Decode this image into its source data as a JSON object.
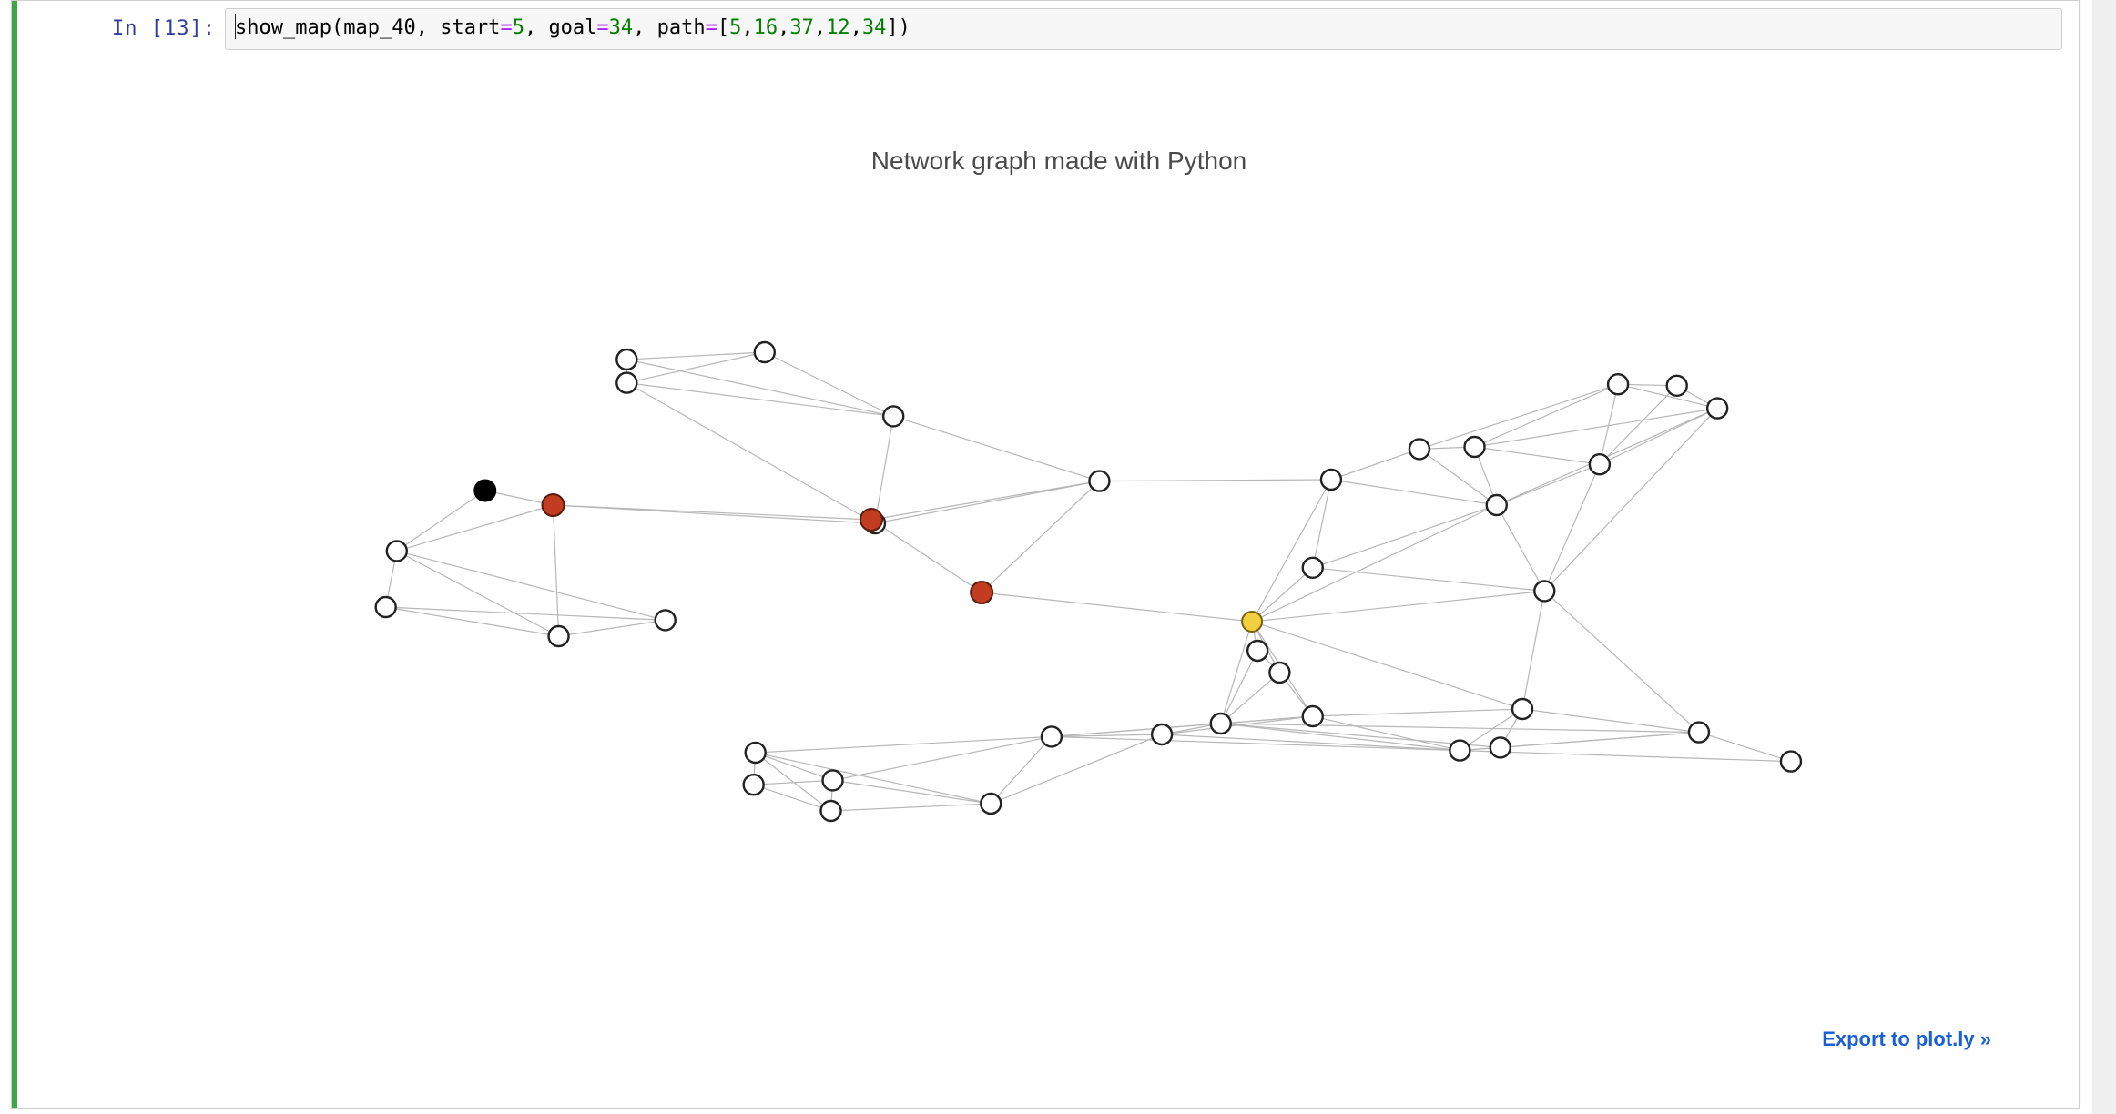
{
  "cell": {
    "prompt_prefix": "In [",
    "prompt_number": "13",
    "prompt_suffix": "]:",
    "code_tokens": [
      {
        "t": "show_map",
        "c": "tok-fn"
      },
      {
        "t": "(",
        "c": "tok-plain"
      },
      {
        "t": "map_40",
        "c": "tok-plain"
      },
      {
        "t": ", ",
        "c": "tok-plain"
      },
      {
        "t": "start",
        "c": "tok-plain"
      },
      {
        "t": "=",
        "c": "tok-eq"
      },
      {
        "t": "5",
        "c": "tok-num"
      },
      {
        "t": ", ",
        "c": "tok-plain"
      },
      {
        "t": "goal",
        "c": "tok-plain"
      },
      {
        "t": "=",
        "c": "tok-eq"
      },
      {
        "t": "34",
        "c": "tok-num"
      },
      {
        "t": ", ",
        "c": "tok-plain"
      },
      {
        "t": "path",
        "c": "tok-plain"
      },
      {
        "t": "=",
        "c": "tok-eq"
      },
      {
        "t": "[",
        "c": "tok-plain"
      },
      {
        "t": "5",
        "c": "tok-num"
      },
      {
        "t": ",",
        "c": "tok-plain"
      },
      {
        "t": "16",
        "c": "tok-num"
      },
      {
        "t": ",",
        "c": "tok-plain"
      },
      {
        "t": "37",
        "c": "tok-num"
      },
      {
        "t": ",",
        "c": "tok-plain"
      },
      {
        "t": "12",
        "c": "tok-num"
      },
      {
        "t": ",",
        "c": "tok-plain"
      },
      {
        "t": "34",
        "c": "tok-num"
      },
      {
        "t": "])",
        "c": "tok-plain"
      }
    ]
  },
  "plot": {
    "title": "Network graph made with Python",
    "export_link": "Export to plot.ly »"
  },
  "chart_data": {
    "type": "network",
    "title": "Network graph made with Python",
    "x_range": [
      0,
      1
    ],
    "y_range": [
      0,
      1
    ],
    "start_node": 5,
    "goal_node": 34,
    "path": [
      5,
      16,
      37,
      12,
      34
    ],
    "node_roles": {
      "start": [
        5
      ],
      "path": [
        16,
        37,
        12
      ],
      "goal": [
        34
      ]
    },
    "nodes": [
      {
        "id": 0,
        "x": 0.265,
        "y": 0.82,
        "role": "none"
      },
      {
        "id": 1,
        "x": 0.265,
        "y": 0.788,
        "role": "none"
      },
      {
        "id": 2,
        "x": 0.34,
        "y": 0.83,
        "role": "none"
      },
      {
        "id": 3,
        "x": 0.41,
        "y": 0.742,
        "role": "none"
      },
      {
        "id": 4,
        "x": 0.4,
        "y": 0.595,
        "role": "none"
      },
      {
        "id": 5,
        "x": 0.188,
        "y": 0.64,
        "role": "start"
      },
      {
        "id": 16,
        "x": 0.225,
        "y": 0.62,
        "role": "path"
      },
      {
        "id": 37,
        "x": 0.398,
        "y": 0.6,
        "role": "path"
      },
      {
        "id": 7,
        "x": 0.522,
        "y": 0.653,
        "role": "none"
      },
      {
        "id": 12,
        "x": 0.458,
        "y": 0.5,
        "role": "path"
      },
      {
        "id": 34,
        "x": 0.605,
        "y": 0.46,
        "role": "goal"
      },
      {
        "id": 6,
        "x": 0.14,
        "y": 0.557,
        "role": "none"
      },
      {
        "id": 8,
        "x": 0.134,
        "y": 0.48,
        "role": "none"
      },
      {
        "id": 9,
        "x": 0.228,
        "y": 0.44,
        "role": "none"
      },
      {
        "id": 10,
        "x": 0.286,
        "y": 0.462,
        "role": "none"
      },
      {
        "id": 20,
        "x": 0.638,
        "y": 0.534,
        "role": "none"
      },
      {
        "id": 21,
        "x": 0.648,
        "y": 0.655,
        "role": "none"
      },
      {
        "id": 22,
        "x": 0.696,
        "y": 0.697,
        "role": "none"
      },
      {
        "id": 23,
        "x": 0.726,
        "y": 0.7,
        "role": "none"
      },
      {
        "id": 24,
        "x": 0.738,
        "y": 0.62,
        "role": "none"
      },
      {
        "id": 25,
        "x": 0.804,
        "y": 0.786,
        "role": "none"
      },
      {
        "id": 26,
        "x": 0.836,
        "y": 0.784,
        "role": "none"
      },
      {
        "id": 27,
        "x": 0.858,
        "y": 0.753,
        "role": "none"
      },
      {
        "id": 28,
        "x": 0.794,
        "y": 0.676,
        "role": "none"
      },
      {
        "id": 29,
        "x": 0.764,
        "y": 0.502,
        "role": "none"
      },
      {
        "id": 30,
        "x": 0.608,
        "y": 0.42,
        "role": "none"
      },
      {
        "id": 31,
        "x": 0.62,
        "y": 0.39,
        "role": "none"
      },
      {
        "id": 32,
        "x": 0.638,
        "y": 0.33,
        "role": "none"
      },
      {
        "id": 33,
        "x": 0.588,
        "y": 0.32,
        "role": "none"
      },
      {
        "id": 35,
        "x": 0.496,
        "y": 0.302,
        "role": "none"
      },
      {
        "id": 36,
        "x": 0.556,
        "y": 0.305,
        "role": "none"
      },
      {
        "id": 38,
        "x": 0.463,
        "y": 0.21,
        "role": "none"
      },
      {
        "id": 39,
        "x": 0.376,
        "y": 0.2,
        "role": "none"
      },
      {
        "id": 40,
        "x": 0.377,
        "y": 0.242,
        "role": "none"
      },
      {
        "id": 41,
        "x": 0.334,
        "y": 0.236,
        "role": "none"
      },
      {
        "id": 42,
        "x": 0.335,
        "y": 0.28,
        "role": "none"
      },
      {
        "id": 43,
        "x": 0.718,
        "y": 0.283,
        "role": "none"
      },
      {
        "id": 44,
        "x": 0.74,
        "y": 0.287,
        "role": "none"
      },
      {
        "id": 45,
        "x": 0.752,
        "y": 0.34,
        "role": "none"
      },
      {
        "id": 46,
        "x": 0.848,
        "y": 0.308,
        "role": "none"
      },
      {
        "id": 47,
        "x": 0.898,
        "y": 0.268,
        "role": "none"
      }
    ],
    "edges": [
      [
        0,
        1
      ],
      [
        0,
        2
      ],
      [
        1,
        2
      ],
      [
        1,
        3
      ],
      [
        2,
        3
      ],
      [
        0,
        3
      ],
      [
        1,
        4
      ],
      [
        5,
        16
      ],
      [
        16,
        4
      ],
      [
        16,
        37
      ],
      [
        3,
        4
      ],
      [
        3,
        7
      ],
      [
        4,
        7
      ],
      [
        37,
        7
      ],
      [
        37,
        12
      ],
      [
        12,
        7
      ],
      [
        12,
        34
      ],
      [
        6,
        8
      ],
      [
        6,
        16
      ],
      [
        6,
        9
      ],
      [
        6,
        10
      ],
      [
        8,
        9
      ],
      [
        8,
        10
      ],
      [
        9,
        10
      ],
      [
        6,
        5
      ],
      [
        9,
        16
      ],
      [
        7,
        21
      ],
      [
        21,
        22
      ],
      [
        22,
        23
      ],
      [
        22,
        24
      ],
      [
        23,
        24
      ],
      [
        21,
        24
      ],
      [
        21,
        20
      ],
      [
        20,
        24
      ],
      [
        22,
        25
      ],
      [
        23,
        25
      ],
      [
        25,
        26
      ],
      [
        25,
        27
      ],
      [
        26,
        27
      ],
      [
        23,
        28
      ],
      [
        24,
        28
      ],
      [
        28,
        25
      ],
      [
        28,
        26
      ],
      [
        28,
        27
      ],
      [
        24,
        27
      ],
      [
        20,
        29
      ],
      [
        24,
        29
      ],
      [
        28,
        29
      ],
      [
        29,
        27
      ],
      [
        23,
        27
      ],
      [
        34,
        20
      ],
      [
        34,
        30
      ],
      [
        34,
        31
      ],
      [
        34,
        32
      ],
      [
        34,
        33
      ],
      [
        34,
        29
      ],
      [
        34,
        21
      ],
      [
        34,
        24
      ],
      [
        34,
        45
      ],
      [
        30,
        31
      ],
      [
        31,
        32
      ],
      [
        32,
        33
      ],
      [
        30,
        33
      ],
      [
        31,
        33
      ],
      [
        33,
        35
      ],
      [
        33,
        36
      ],
      [
        35,
        36
      ],
      [
        36,
        38
      ],
      [
        35,
        38
      ],
      [
        35,
        40
      ],
      [
        35,
        42
      ],
      [
        40,
        42
      ],
      [
        41,
        42
      ],
      [
        41,
        40
      ],
      [
        41,
        39
      ],
      [
        39,
        40
      ],
      [
        39,
        38
      ],
      [
        40,
        38
      ],
      [
        42,
        38
      ],
      [
        42,
        39
      ],
      [
        32,
        35
      ],
      [
        32,
        36
      ],
      [
        32,
        43
      ],
      [
        33,
        43
      ],
      [
        33,
        44
      ],
      [
        43,
        44
      ],
      [
        43,
        45
      ],
      [
        44,
        45
      ],
      [
        44,
        46
      ],
      [
        45,
        46
      ],
      [
        46,
        47
      ],
      [
        43,
        46
      ],
      [
        43,
        47
      ],
      [
        32,
        45
      ],
      [
        33,
        46
      ],
      [
        29,
        45
      ],
      [
        29,
        46
      ],
      [
        35,
        43
      ],
      [
        36,
        43
      ]
    ]
  }
}
